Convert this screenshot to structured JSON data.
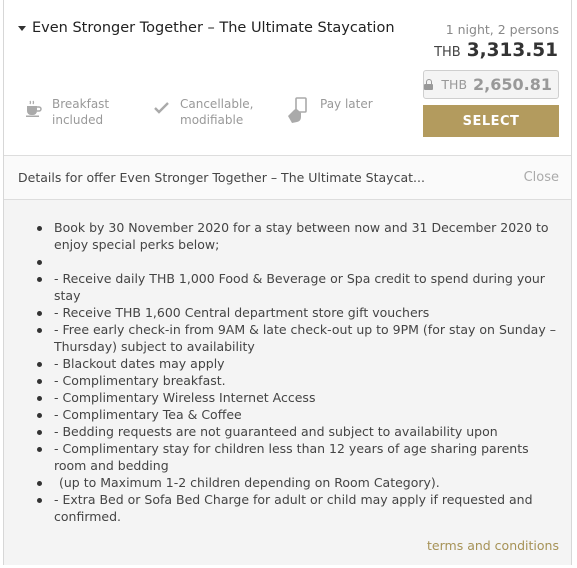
{
  "offer": {
    "title": "Even Stronger Together – The Ultimate Staycation",
    "occupancy": "1 night, 2 persons",
    "price_currency": "THB",
    "price_amount": "3,313.51",
    "member_price_currency": "THB",
    "member_price_amount": "2,650.81",
    "select_label": "SELECT",
    "features": [
      {
        "icon": "cup-icon",
        "label_line1": "Breakfast",
        "label_line2": "included"
      },
      {
        "icon": "checkmark-icon",
        "label_line1": "Cancellable,",
        "label_line2": "modifiable"
      },
      {
        "icon": "pay-later-icon",
        "label_line1": "Pay later",
        "label_line2": ""
      }
    ]
  },
  "details": {
    "header_text": "Details for offer Even Stronger Together – The Ultimate Staycat...",
    "close_label": "Close",
    "perks": [
      "Book by 30 November 2020 for a stay between now and 31 December 2020 to enjoy special perks below;",
      "",
      "- Receive daily THB 1,000 Food & Beverage or Spa credit to spend during your stay",
      "- Receive THB 1,600 Central department store gift vouchers",
      "- Free early check-in from 9AM & late check-out up to 9PM (for stay on Sunday – Thursday) subject to availability",
      "- Blackout dates may apply",
      "- Complimentary breakfast.",
      "- Complimentary Wireless Internet Access",
      "- Complimentary Tea & Coffee",
      "- Bedding requests are not guaranteed and subject to availability upon",
      "- Complimentary stay for children less than 12 years of age sharing parents room and bedding",
      "(up to Maximum 1-2 children depending on Room Category).",
      "- Extra Bed or Sofa Bed Charge for adult or child may apply if requested and confirmed."
    ],
    "terms_label": "terms and conditions"
  },
  "colors": {
    "accent_gold": "#b39b5e",
    "muted_text": "#999999",
    "details_bg": "#f4f4f4"
  }
}
